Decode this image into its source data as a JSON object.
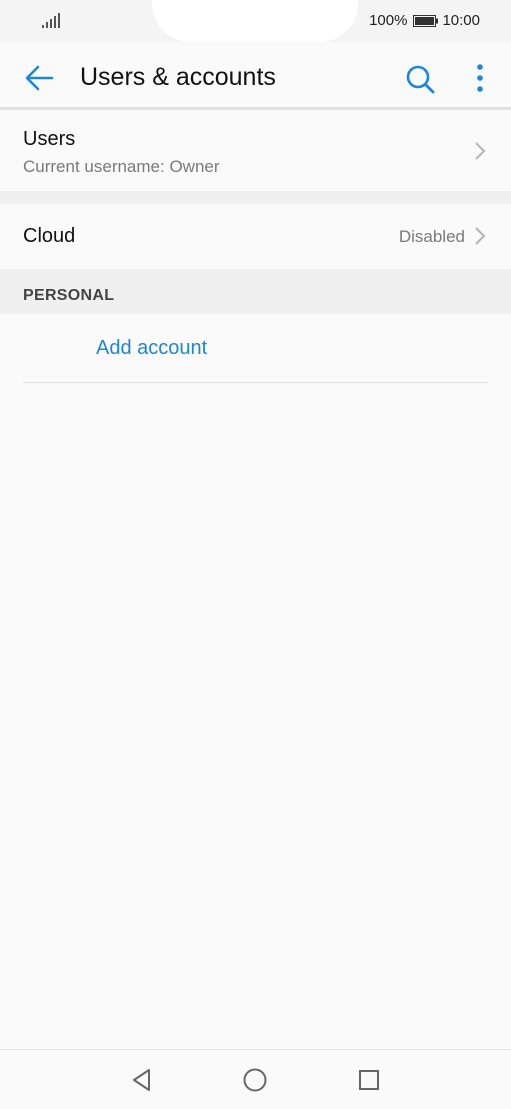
{
  "status_bar": {
    "battery_percent": "100%",
    "time": "10:00"
  },
  "app_bar": {
    "title": "Users & accounts",
    "icons": [
      "back-arrow-icon",
      "search-icon",
      "more-vert-icon"
    ]
  },
  "users_row": {
    "label": "Users",
    "subtitle": "Current username: Owner"
  },
  "cloud_row": {
    "label": "Cloud",
    "value": "Disabled"
  },
  "personal_section": {
    "header": "PERSONAL",
    "add_account_label": "Add account"
  },
  "nav_bar": {
    "icons": [
      "back-triangle-icon",
      "home-circle-icon",
      "recents-square-icon"
    ]
  },
  "colors": {
    "accent": "#1a87d8",
    "background": "#fafafa",
    "section_bg": "#f0f0f0"
  }
}
